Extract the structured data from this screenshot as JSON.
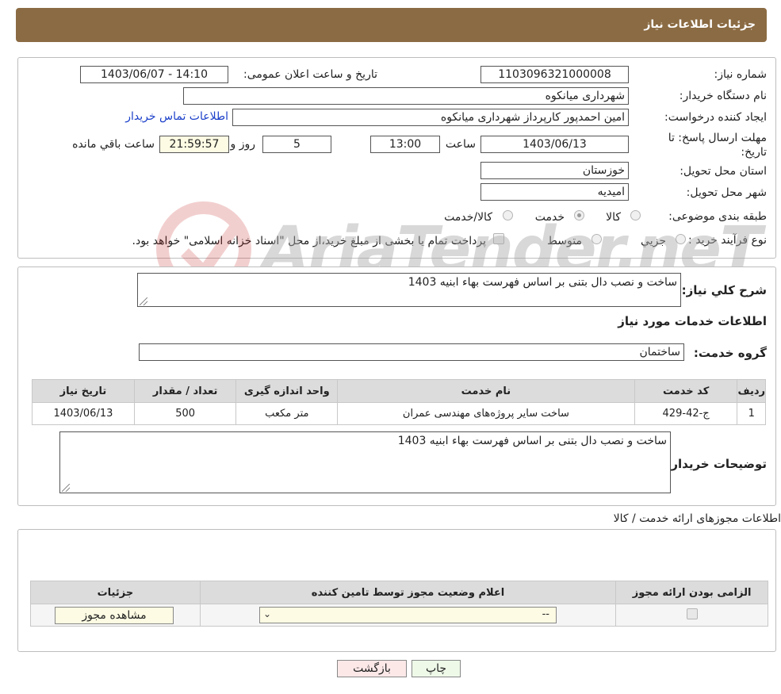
{
  "header": {
    "title": "جزئیات اطلاعات نیاز"
  },
  "details": {
    "need_number_label": "شماره نیاز:",
    "need_number": "1103096321000008",
    "announce_label": "تاریخ و ساعت اعلان عمومی:",
    "announce_value": "1403/06/07 - 14:10",
    "buyer_org_label": "نام دستگاه خریدار:",
    "buyer_org": "شهرداری میانکوه",
    "creator_label": "ایجاد کننده درخواست:",
    "creator": "امین احمدپور کارپرداز شهرداری میانکوه",
    "contact_link": "اطلاعات تماس خریدار",
    "deadline_label": "مهلت ارسال پاسخ: تا تاریخ:",
    "deadline_date": "1403/06/13",
    "time_label": "ساعت",
    "deadline_time": "13:00",
    "days_value": "5",
    "days_label": "روز و",
    "remaining_value": "21:59:57",
    "remaining_label": "ساعت باقي مانده",
    "province_label": "استان محل تحویل:",
    "province": "خوزستان",
    "city_label": "شهر محل تحویل:",
    "city": "امیدیه",
    "category_label": "طبقه بندی موضوعی:",
    "category_options": [
      "کالا",
      "خدمت",
      "کالا/خدمت"
    ],
    "category_selected": "خدمت",
    "process_label": "نوع فرآیند خرید :",
    "process_options": [
      "جزیي",
      "متوسط"
    ],
    "process_note": "پرداخت تمام یا بخشی از مبلغ خرید،از محل \"اسناد خزانه اسلامی\" خواهد بود."
  },
  "services": {
    "summary_label": "شرح کلي نياز:",
    "summary": "ساخت و نصب دال بتنی بر اساس فهرست بهاء ابنیه 1403",
    "section_title": "اطلاعات خدمات مورد نیاز",
    "group_label": "گروه خدمت:",
    "group": "ساختمان",
    "table_headers": [
      "ردیف",
      "کد خدمت",
      "نام خدمت",
      "واحد اندازه گیری",
      "تعداد / مقدار",
      "تاریخ نیاز"
    ],
    "table_rows": [
      [
        "1",
        "ج-42-429",
        "ساخت سایر پروژه‌های مهندسی عمران",
        "متر مکعب",
        "500",
        "1403/06/13"
      ]
    ],
    "buyer_notes_label": "توضیحات خریدار:",
    "buyer_notes": "ساخت و نصب دال بتنی بر اساس فهرست بهاء ابنیه 1403"
  },
  "permits": {
    "section_title": "اطلاعات مجوزهای ارائه خدمت / کالا",
    "table_headers": [
      "الزامی بودن ارائه مجوز",
      "اعلام وضعیت مجوز توسط تامین کننده",
      "جزئیات"
    ],
    "select_value": "--",
    "view_button": "مشاهده مجوز"
  },
  "actions": {
    "print": "چاپ",
    "back": "بازگشت"
  },
  "watermark": "AriaTender.neT",
  "colors": {
    "header_bg": "#8b6b43",
    "link": "#1a3fc9",
    "back_btn_bg": "#fde8e8",
    "print_btn_bg": "#eef9e8"
  }
}
